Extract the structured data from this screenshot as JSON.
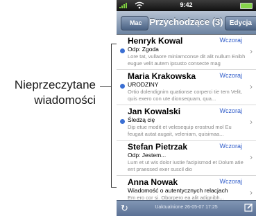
{
  "callout": {
    "line1": "Nieprzeczytane",
    "line2": "wiadomości"
  },
  "status_bar": {
    "time": "9:42",
    "icons": [
      "signal-icon",
      "wifi-icon",
      "battery-icon"
    ]
  },
  "nav_bar": {
    "back_label": "Mac",
    "title": "Przychodzące (3)",
    "edit_label": "Edycja"
  },
  "messages": [
    {
      "sender": "Henryk Kowal",
      "date": "Wczoraj",
      "subject": "Odp: Zgoda",
      "preview": "Lore tat, vullaore miniamconse dit alit nullum Enibh eugue velit autem ipsusto consecte mag",
      "unread": true
    },
    {
      "sender": "Maria Krakowska",
      "date": "Wczoraj",
      "subject": "URODZINY",
      "preview": "Ortio dolendignim quationse corperci tie tem Velit, quis exero con ute dionsequam, qua...",
      "unread": true
    },
    {
      "sender": "Jan Kowalski",
      "date": "Wczoraj",
      "subject": "Śledzą cię",
      "preview": "Dip etue modit et velesequip erostrud mol Eu feugait autat augait, veleniam, quisimaa...",
      "unread": true
    },
    {
      "sender": "Stefan Pietrzak",
      "date": "Wczoraj",
      "subject": "Odp: Jestem...",
      "preview": "Lum et ut wis dolor iustie facipismod et Dolum atie ent praessed exer suscil dio",
      "unread": false
    },
    {
      "sender": "Anna Nowak",
      "date": "Wczoraj",
      "subject": "Wiadomość o autentycznych relacjach",
      "preview": "Em ero cor si. Oborpero ea alit adignibh...",
      "unread": false
    }
  ],
  "toolbar": {
    "updated_text": "Uaktualnione 26-05-07  17:25",
    "icons": [
      "refresh-icon",
      "compose-icon"
    ]
  },
  "colors": {
    "unread_dot": "#3b6fd3",
    "date_text": "#2e5bc9",
    "nav_gradient_top": "#b7c3d3",
    "nav_gradient_bottom": "#6d84a2"
  }
}
